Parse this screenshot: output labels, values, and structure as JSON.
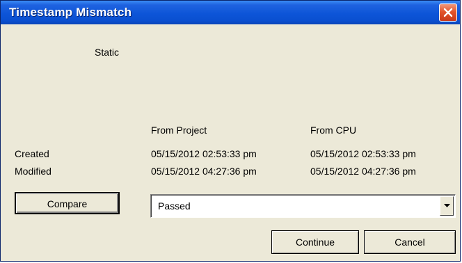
{
  "window": {
    "title": "Timestamp Mismatch"
  },
  "static_label": "Static",
  "columns": {
    "from_project": "From Project",
    "from_cpu": "From CPU"
  },
  "rows": [
    {
      "label": "Created",
      "project": "05/15/2012  02:53:33 pm",
      "cpu": "05/15/2012  02:53:33 pm"
    },
    {
      "label": "Modified",
      "project": "05/15/2012  04:27:36 pm",
      "cpu": "05/15/2012  04:27:36 pm"
    }
  ],
  "compare_button": "Compare",
  "result_combo": {
    "value": "Passed"
  },
  "buttons": {
    "continue": "Continue",
    "cancel": "Cancel"
  },
  "icons": {
    "close": "close-icon",
    "dropdown": "chevron-down-icon"
  },
  "colors": {
    "titlebar": "#0d55d8",
    "dialog_bg": "#ece9d8",
    "close_button": "#e2542b"
  }
}
